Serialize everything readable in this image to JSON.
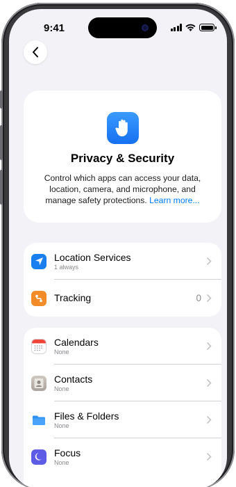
{
  "status_bar": {
    "time": "9:41"
  },
  "header": {
    "title": "Privacy & Security",
    "description": "Control which apps can access your data, location, camera, and microphone, and manage safety protections.",
    "learn_more": "Learn more..."
  },
  "colors": {
    "accent": "#007aff",
    "location": "#1a7ff0",
    "tracking": "#f28c28",
    "files": "#2f8ff2",
    "focus": "#5e5ce6"
  },
  "group1": [
    {
      "title": "Location Services",
      "subtitle": "1 always",
      "value": "",
      "icon": "location-arrow-icon"
    },
    {
      "title": "Tracking",
      "subtitle": "",
      "value": "0",
      "icon": "tracking-icon"
    }
  ],
  "group2": [
    {
      "title": "Calendars",
      "subtitle": "None",
      "icon": "calendar-icon"
    },
    {
      "title": "Contacts",
      "subtitle": "None",
      "icon": "contacts-icon"
    },
    {
      "title": "Files & Folders",
      "subtitle": "None",
      "icon": "folder-icon"
    },
    {
      "title": "Focus",
      "subtitle": "None",
      "icon": "moon-icon"
    }
  ]
}
